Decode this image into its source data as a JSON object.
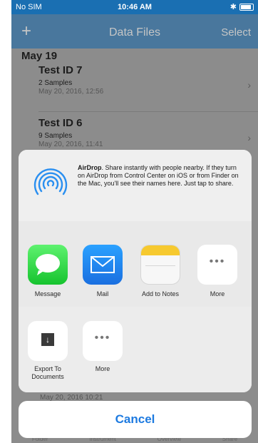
{
  "status_bar": {
    "carrier": "No SIM",
    "wifi_icon": "wifi-icon",
    "time": "10:46 AM",
    "bluetooth": "✱",
    "battery_icon": "battery-icon"
  },
  "nav": {
    "add": "+",
    "title": "Data Files",
    "select": "Select"
  },
  "list": {
    "section": "May 19",
    "items": [
      {
        "name": "Test ID 7",
        "samples": "2 Samples",
        "date": "May 20, 2016, 12:56"
      },
      {
        "name": "Test ID 6",
        "samples": "9 Samples",
        "date": "May 20, 2016, 11:41"
      }
    ],
    "behind_date": "May 20, 2016 10:21",
    "tab_hints": [
      "Folder",
      "Instrument",
      "Overview",
      "Share"
    ]
  },
  "share_sheet": {
    "airdrop_title": "AirDrop",
    "airdrop_text": ". Share instantly with people nearby. If they turn on AirDrop from Control Center on iOS or from Finder on the Mac, you'll see their names here. Just tap to share.",
    "apps": [
      {
        "label": "Message",
        "icon": "message-icon"
      },
      {
        "label": "Mail",
        "icon": "mail-icon"
      },
      {
        "label": "Add to Notes",
        "icon": "notes-icon"
      },
      {
        "label": "More",
        "icon": "more-icon"
      }
    ],
    "actions": [
      {
        "label": "Export To Documents",
        "icon": "export-icon"
      },
      {
        "label": "More",
        "icon": "more-icon"
      }
    ],
    "more_glyph": "•••",
    "export_glyph": "↓"
  },
  "cancel_label": "Cancel",
  "colors": {
    "accent": "#1d7ae0",
    "nav": "#1e73b8"
  }
}
